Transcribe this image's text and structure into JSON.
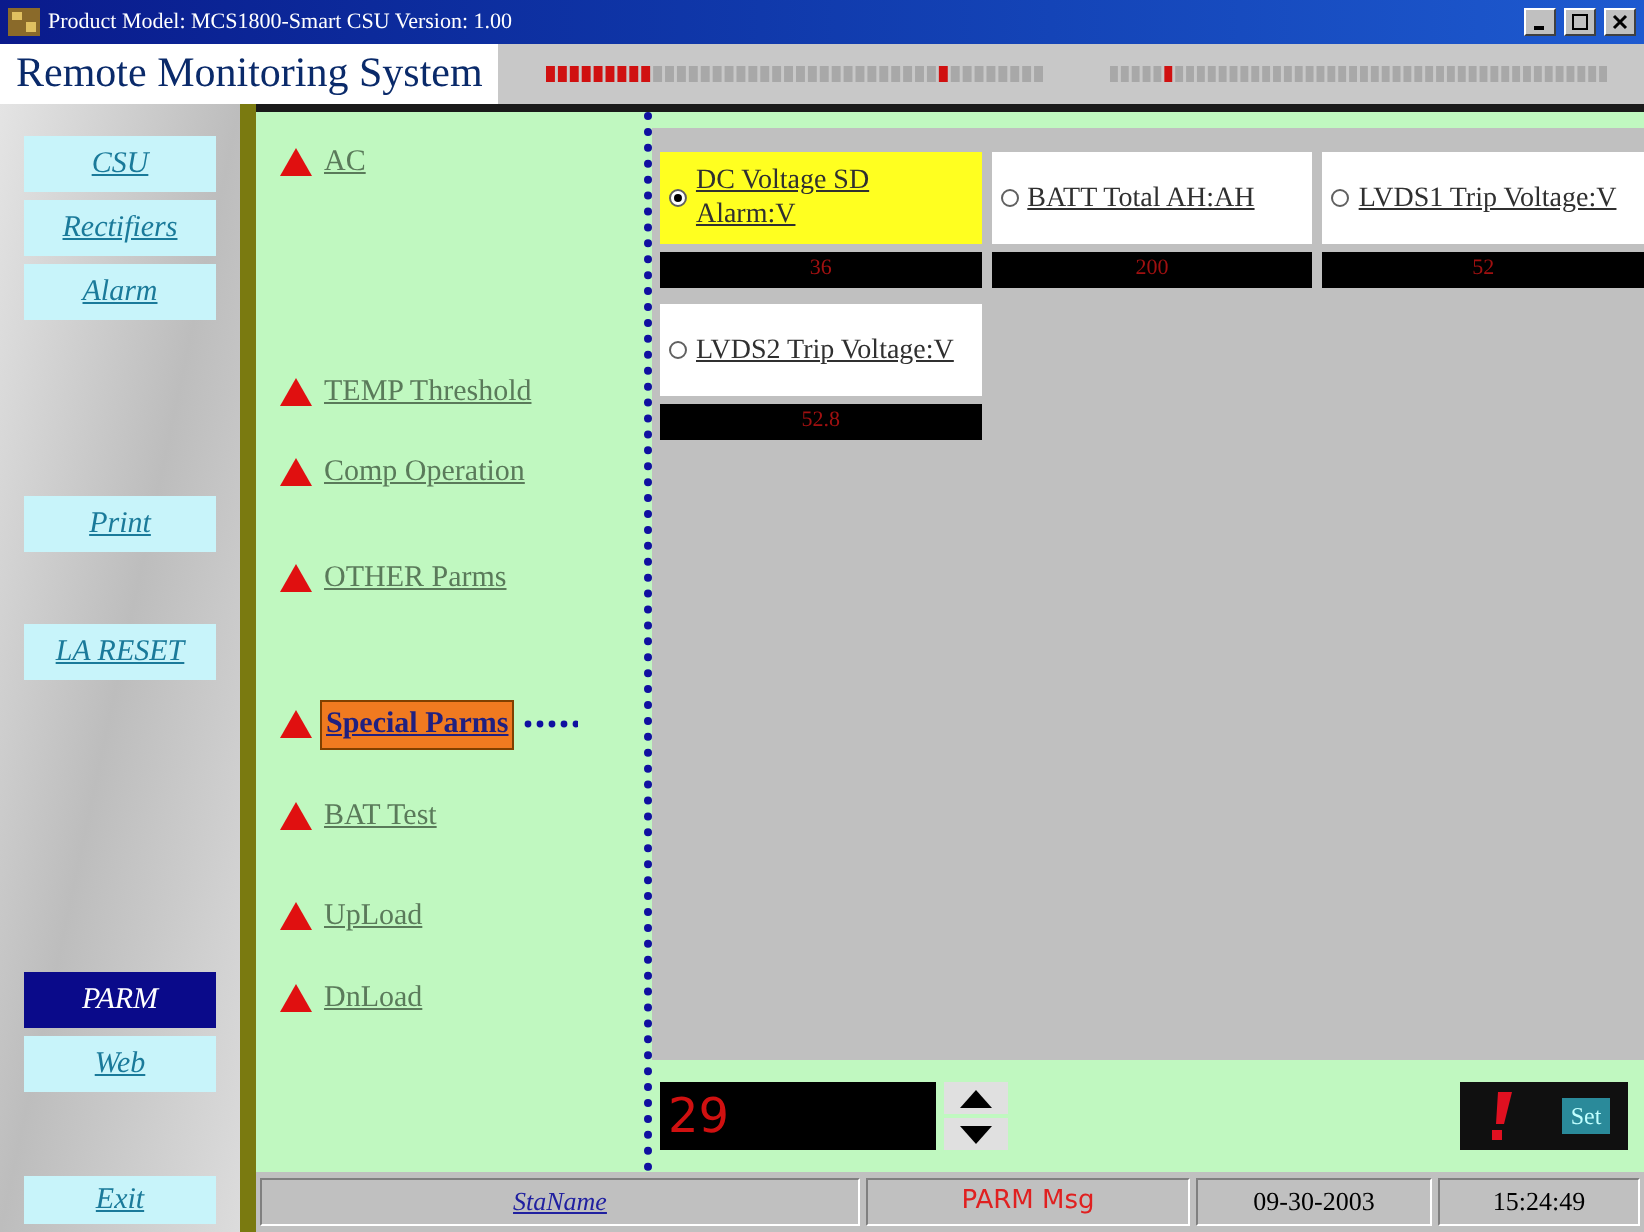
{
  "window": {
    "title": "Product Model: MCS1800-Smart CSU Version: 1.00"
  },
  "app_title": "Remote Monitoring System",
  "sidebar": {
    "items": [
      {
        "label": "CSU",
        "selected": false
      },
      {
        "label": "Rectifiers",
        "selected": false
      },
      {
        "label": "Alarm",
        "selected": false
      },
      {
        "label": "Print",
        "selected": false
      },
      {
        "label": "LA RESET",
        "selected": false
      },
      {
        "label": "PARM",
        "selected": true
      },
      {
        "label": "Web",
        "selected": false
      }
    ],
    "exit": "Exit"
  },
  "menu": [
    {
      "label": "AC",
      "selected": false
    },
    {
      "label": "TEMP Threshold",
      "selected": false
    },
    {
      "label": "Comp Operation",
      "selected": false
    },
    {
      "label": "OTHER Parms",
      "selected": false
    },
    {
      "label": "Special Parms",
      "selected": true
    },
    {
      "label": "BAT Test",
      "selected": false
    },
    {
      "label": "UpLoad",
      "selected": false
    },
    {
      "label": "DnLoad",
      "selected": false
    }
  ],
  "params": [
    {
      "label": "DC Voltage SD Alarm:V",
      "value": "36",
      "selected": true
    },
    {
      "label": "BATT Total AH:AH",
      "value": "200",
      "selected": false
    },
    {
      "label": "LVDS1 Trip Voltage:V",
      "value": "52",
      "selected": false
    },
    {
      "label": "LVDS2 Trip Voltage:V",
      "value": "52.8",
      "selected": false
    }
  ],
  "entry": {
    "value": "29"
  },
  "set_button": "Set",
  "status_bar": [
    "StaName",
    "PARM Msg",
    "09-30-2003",
    "15:24:49"
  ]
}
